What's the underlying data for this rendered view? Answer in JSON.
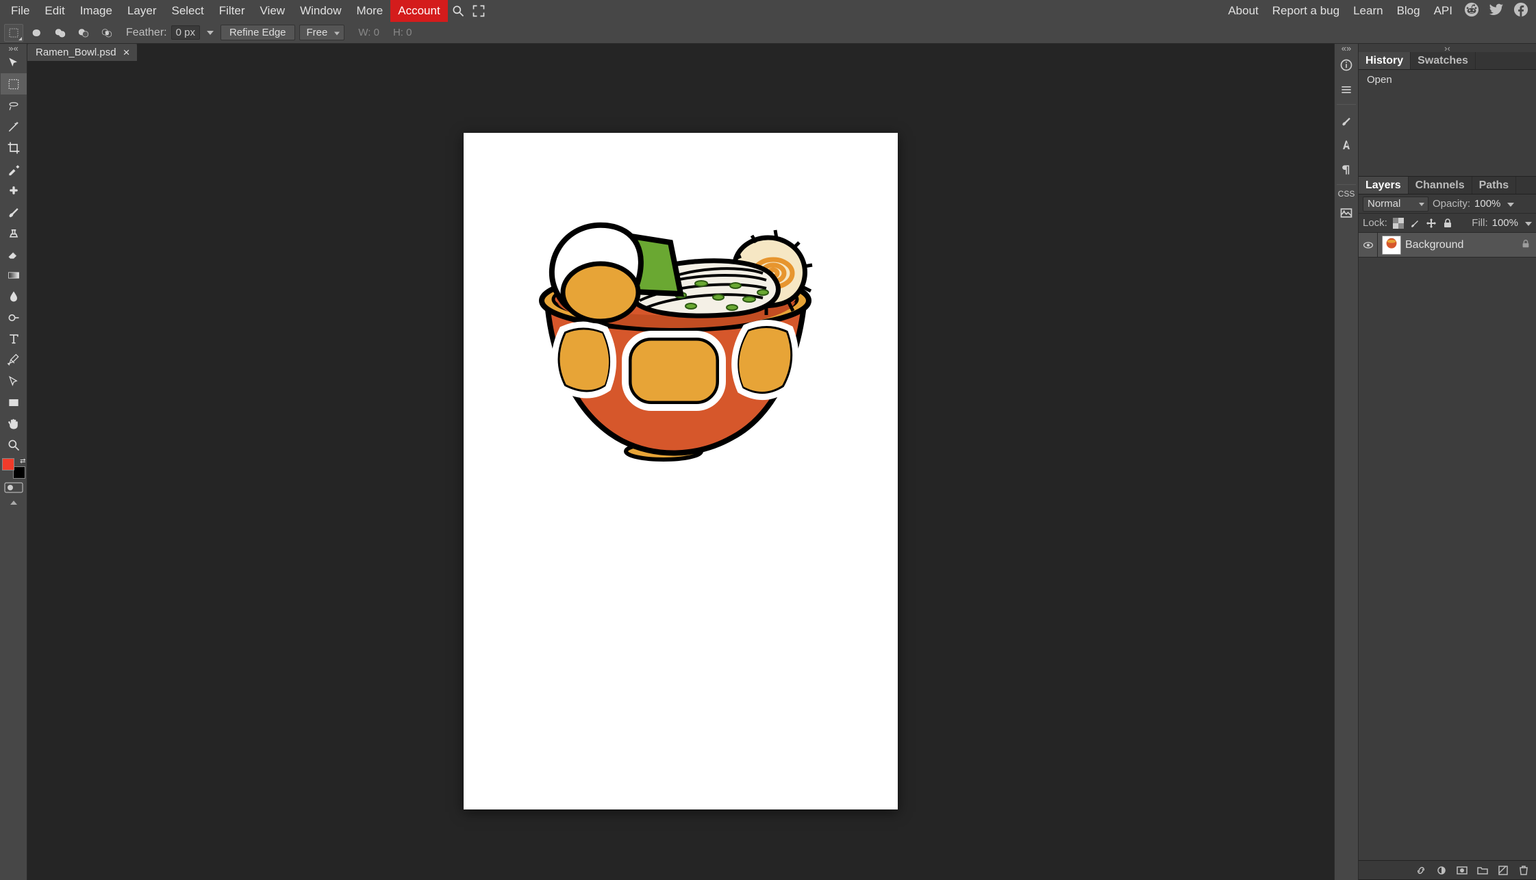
{
  "menubar": {
    "left": [
      "File",
      "Edit",
      "Image",
      "Layer",
      "Select",
      "Filter",
      "View",
      "Window",
      "More",
      "Account"
    ],
    "accent_index": 9,
    "right_links": [
      "About",
      "Report a bug",
      "Learn",
      "Blog",
      "API"
    ]
  },
  "optionsbar": {
    "feather_label": "Feather:",
    "feather_value": "0 px",
    "refine_edge": "Refine Edge",
    "mode_select": "Free",
    "w_label": "W:",
    "w_value": "0",
    "h_label": "H:",
    "h_value": "0"
  },
  "document_tab": {
    "title": "Ramen_Bowl.psd"
  },
  "colors": {
    "foreground": "#f03b2a",
    "background": "#000000"
  },
  "rightstrip": {
    "css_label": "CSS"
  },
  "panel_history": {
    "tabs": [
      "History",
      "Swatches"
    ],
    "active": 0,
    "items": [
      "Open"
    ]
  },
  "panel_layers": {
    "tabs": [
      "Layers",
      "Channels",
      "Paths"
    ],
    "active": 0,
    "blend_mode": "Normal",
    "opacity_label": "Opacity:",
    "opacity_value": "100%",
    "lock_label": "Lock:",
    "fill_label": "Fill:",
    "fill_value": "100%",
    "layers": [
      {
        "name": "Background",
        "locked": true,
        "visible": true
      }
    ]
  }
}
